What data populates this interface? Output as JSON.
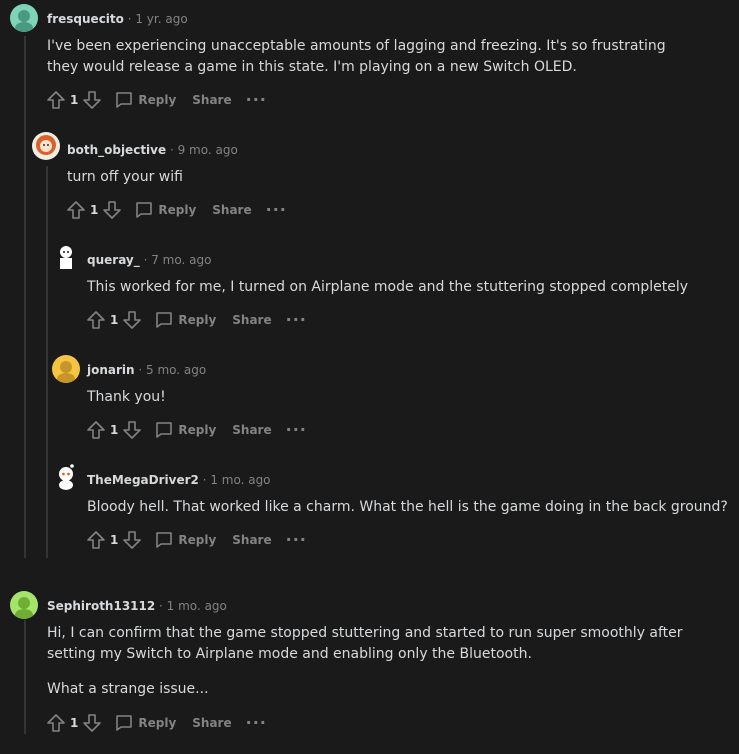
{
  "labels": {
    "reply": "Reply",
    "share": "Share"
  },
  "comments": [
    {
      "author": "fresquecito",
      "time": "1 yr. ago",
      "score": "1",
      "body": [
        "I've been experiencing unacceptable amounts of lagging and freezing. It's so frustrating they would release a game in this state. I'm playing on a new Switch OLED."
      ]
    },
    {
      "author": "both_objective",
      "time": "9 mo. ago",
      "score": "1",
      "body": [
        "turn off your wifi"
      ]
    },
    {
      "author": "queray_",
      "time": "7 mo. ago",
      "score": "1",
      "body": [
        "This worked for me, I turned on Airplane mode and the stuttering stopped completely"
      ]
    },
    {
      "author": "jonarin",
      "time": "5 mo. ago",
      "score": "1",
      "body": [
        "Thank you!"
      ]
    },
    {
      "author": "TheMegaDriver2",
      "time": "1 mo. ago",
      "score": "1",
      "body": [
        "Bloody hell. That worked like a charm. What the hell is the game doing in the back ground?"
      ]
    },
    {
      "author": "Sephiroth13112",
      "time": "1 mo. ago",
      "score": "1",
      "body": [
        "Hi, I can confirm that the game stopped stuttering and started to run super smoothly after setting my Switch to Airplane mode and enabling only the Bluetooth.",
        "What a strange issue..."
      ]
    }
  ],
  "avatar_colors": [
    "#7fd3b8",
    "#f1ede2",
    "#ffffff",
    "#f5c542",
    "#ffffff",
    "#a6e36b"
  ]
}
